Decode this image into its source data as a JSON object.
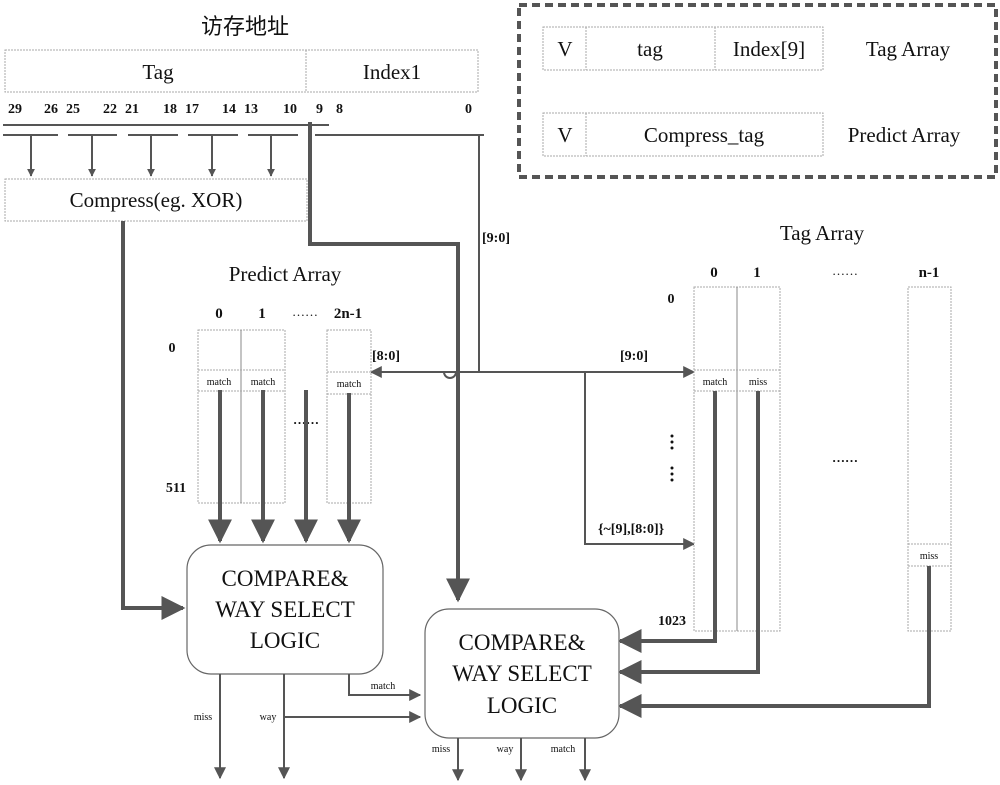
{
  "address": {
    "title": "访存地址",
    "fields": {
      "tag": "Tag",
      "index": "Index1"
    },
    "bit_labels": [
      "29",
      "26",
      "25",
      "22",
      "21",
      "18",
      "17",
      "14",
      "13",
      "10",
      "9",
      "8",
      "0"
    ]
  },
  "compress": {
    "label": "Compress(eg. XOR)"
  },
  "legend": {
    "tag_array": {
      "v": "V",
      "tag": "tag",
      "index": "Index[9]",
      "name": "Tag Array"
    },
    "predict_array": {
      "v": "V",
      "tag": "Compress_tag",
      "name": "Predict Array"
    }
  },
  "predict_array": {
    "title": "Predict Array",
    "columns": [
      "0",
      "1",
      "2n-1"
    ],
    "column_ellipsis": "……",
    "rows": {
      "first": "0",
      "last": "511"
    },
    "cell_label": "match",
    "index_label": "[8:0]"
  },
  "tag_array": {
    "title": "Tag Array",
    "columns": [
      "0",
      "1",
      "n-1"
    ],
    "column_ellipsis": "……",
    "rows": {
      "first": "0",
      "last": "1023"
    },
    "cell_labels": [
      "match",
      "miss",
      "miss"
    ],
    "index_label_primary": "[9:0]",
    "index_label_alt": "{~[9],[8:0]}"
  },
  "bus_label": "[9:0]",
  "compare_logic": {
    "label_lines": [
      "COMPARE&",
      "WAY SELECT",
      "LOGIC"
    ]
  },
  "signals": {
    "miss": "miss",
    "way": "way",
    "match": "match"
  },
  "colors": {
    "line": "#555555",
    "box_border": "#a8a8a8",
    "text": "#111111"
  }
}
